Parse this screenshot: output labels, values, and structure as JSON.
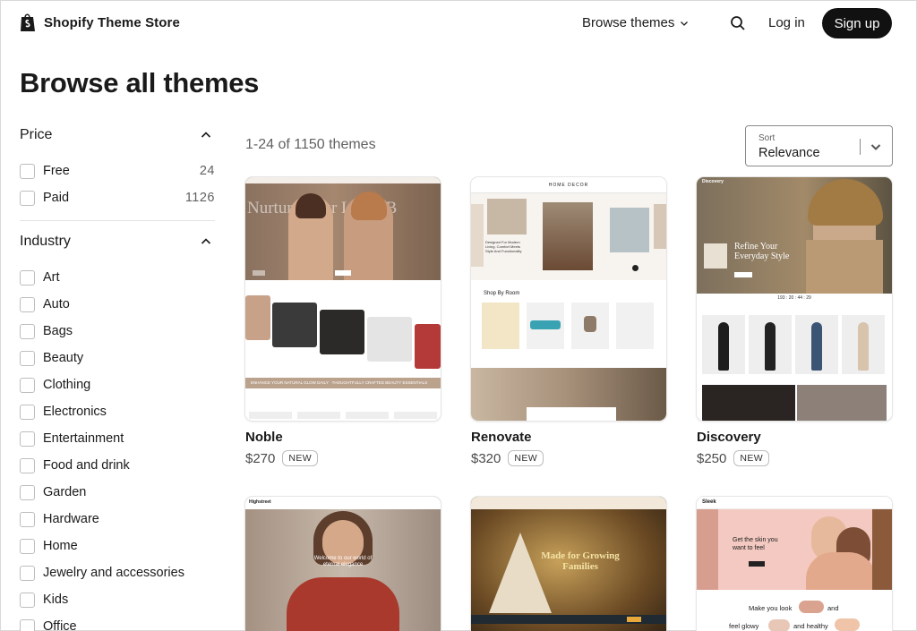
{
  "header": {
    "logo_text": "Shopify Theme Store",
    "browse_label": "Browse themes",
    "login_label": "Log in",
    "signup_label": "Sign up"
  },
  "page_title": "Browse all themes",
  "filters": {
    "price": {
      "title": "Price",
      "items": [
        {
          "label": "Free",
          "count": "24"
        },
        {
          "label": "Paid",
          "count": "1126"
        }
      ]
    },
    "industry": {
      "title": "Industry",
      "items": [
        {
          "label": "Art"
        },
        {
          "label": "Auto"
        },
        {
          "label": "Bags"
        },
        {
          "label": "Beauty"
        },
        {
          "label": "Clothing"
        },
        {
          "label": "Electronics"
        },
        {
          "label": "Entertainment"
        },
        {
          "label": "Food and drink"
        },
        {
          "label": "Garden"
        },
        {
          "label": "Hardware"
        },
        {
          "label": "Home"
        },
        {
          "label": "Jewelry and accessories"
        },
        {
          "label": "Kids"
        },
        {
          "label": "Office"
        }
      ]
    }
  },
  "results": {
    "count_text": "1-24 of 1150 themes",
    "sort_label": "Sort",
    "sort_value": "Relevance"
  },
  "themes": [
    {
      "name": "Noble",
      "price": "$270",
      "badge": "NEW",
      "preview_hero": "Nurture Your Look, B",
      "preview_band": "ENHANCE YOUR NATURAL GLOW DAILY  ·  THOUGHTFULLY CRAFTED BEAUTY ESSENTIALS"
    },
    {
      "name": "Renovate",
      "price": "$320",
      "badge": "NEW",
      "preview_logo": "HOME DECOR",
      "preview_heading": "Designed For Modern Living. Comfort Meets Style And Functionality",
      "preview_section": "Shop By Room"
    },
    {
      "name": "Discovery",
      "price": "$250",
      "badge": "NEW",
      "preview_logo": "Discovery",
      "preview_hero": "Refine Your Everyday Style",
      "preview_timer": "193 : 20 : 44 : 29"
    },
    {
      "name": "",
      "price": "",
      "badge": "",
      "preview_logo": "Highstreet",
      "preview_hero": "Welcome to our world of eternal elegance"
    },
    {
      "name": "",
      "price": "",
      "badge": "",
      "preview_hero": "Made for Growing Families"
    },
    {
      "name": "",
      "price": "",
      "badge": "",
      "preview_logo": "Sleek",
      "preview_hero": "Get the skin you want to feel",
      "preview_line1": "Make you look",
      "preview_line2": "and",
      "preview_line3": "feel glowy",
      "preview_line4": "and healthy"
    }
  ],
  "colors": {
    "accent": "#111111",
    "muted": "#616161",
    "badge_border": "#bdbdbd"
  }
}
